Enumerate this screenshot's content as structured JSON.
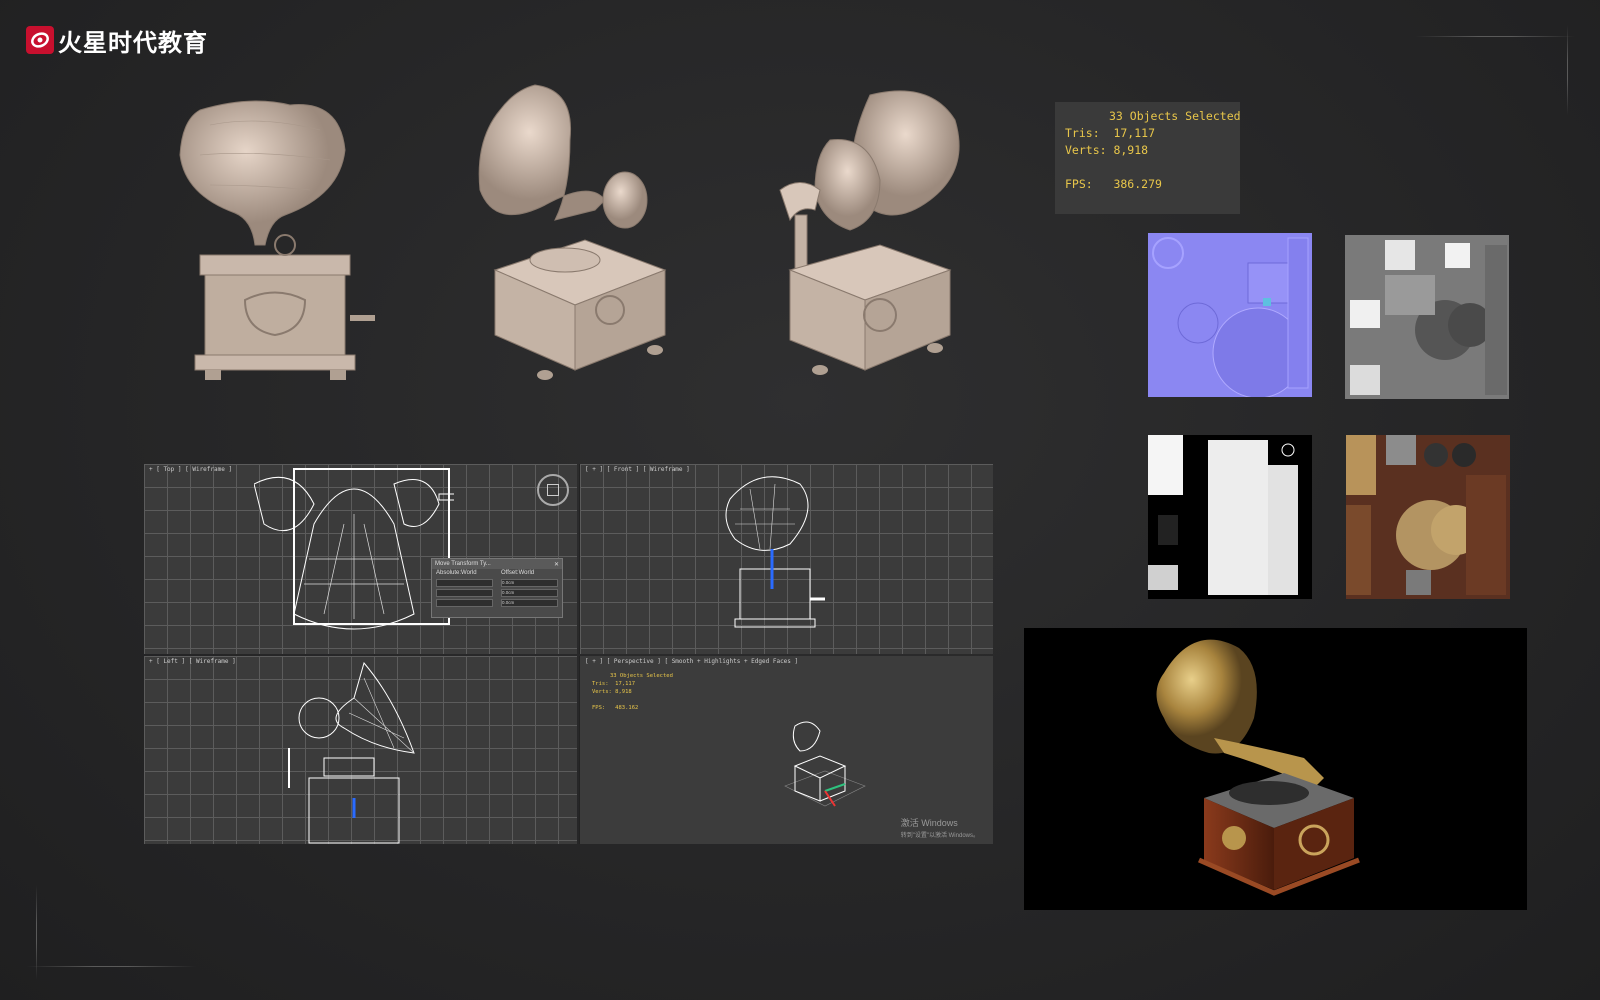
{
  "brand": {
    "name": "火星时代教育",
    "accent": "#c8102e"
  },
  "stats": {
    "selected": "33 Objects Selected",
    "tris": "Tris:  17,117",
    "verts": "Verts: 8,918",
    "fps": "FPS:   386.279"
  },
  "textures": [
    "normal-map",
    "roughness-map",
    "metallic-map",
    "albedo-map"
  ],
  "viewports": {
    "top": {
      "label": "+ [ Top ] [ Wireframe ]"
    },
    "front": {
      "label": "[ + ] [ Front ] [ Wireframe ]"
    },
    "left": {
      "label": "+ [ Left ] [ Wireframe ]"
    },
    "perspective": {
      "label": "[ + ] [ Perspective ] [ Smooth + Highlights + Edged Faces ]",
      "selected": "33 Objects Selected",
      "tris": "Tris:  17,117",
      "verts": "Verts: 8,918",
      "fps": "FPS:   483.162"
    }
  },
  "transform_dialog": {
    "title": "Move Transform Ty...",
    "absolute": "Absolute:World",
    "offset": "Offset:World",
    "x": "X:",
    "y": "Y:",
    "z": "Z:",
    "offset_value": "0.0cm"
  },
  "watermark": {
    "line1": "激活 Windows",
    "line2": "转到\"设置\"以激活 Windows。"
  }
}
